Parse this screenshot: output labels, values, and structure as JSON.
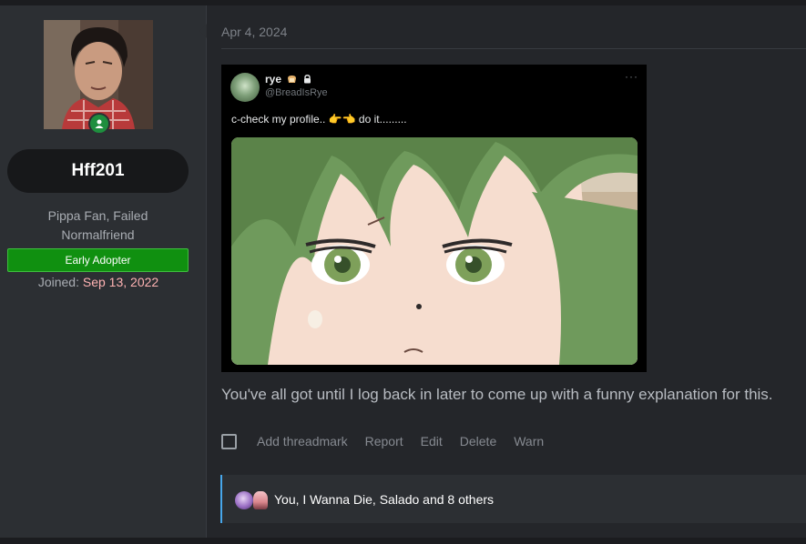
{
  "user": {
    "username": "Hff201",
    "title": "Pippa Fan, Failed Normalfriend",
    "badge": "Early Adopter",
    "joined_label": "Joined:",
    "joined_date": "Sep 13, 2022"
  },
  "post": {
    "date": "Apr 4, 2024",
    "embed": {
      "name": "rye",
      "handle": "@BreadIsRye",
      "more": "···",
      "text": "c-check my profile.. 👉👈 do it........."
    },
    "body": "You've all got until I log back in later to come up with a funny explanation for this.",
    "actions": [
      "Add threadmark",
      "Report",
      "Edit",
      "Delete",
      "Warn"
    ],
    "reactions_text": "You, I Wanna Die, Salado and 8 others"
  },
  "colors": {
    "background": "#24262a",
    "panel": "#2c2f33",
    "badge_green": "#109010",
    "joined_date": "#ffb3b3",
    "reaction_accent": "#47a7eb"
  },
  "icons": {
    "online": "user-online-icon",
    "checkbox": "checkbox-icon",
    "bread": "bread-emoji-icon",
    "lock": "lock-icon"
  }
}
